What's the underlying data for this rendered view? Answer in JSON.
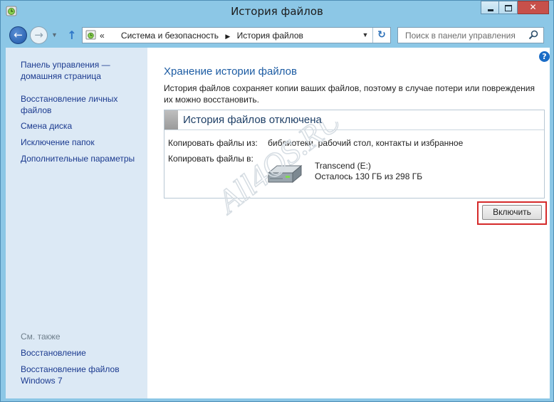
{
  "window": {
    "title": "История файлов"
  },
  "nav": {
    "breadcrumb_prefix": "«",
    "breadcrumb": [
      "Система и безопасность",
      "История файлов"
    ],
    "search_placeholder": "Поиск в панели управления"
  },
  "sidebar": {
    "items": [
      {
        "label": "Панель управления — домашняя страница"
      },
      {
        "label": "Восстановление личных файлов"
      },
      {
        "label": "Смена диска"
      },
      {
        "label": "Исключение папок"
      },
      {
        "label": "Дополнительные параметры"
      }
    ],
    "see_also_label": "См. также",
    "see_also": [
      {
        "label": "Восстановление"
      },
      {
        "label": "Восстановление файлов Windows 7"
      }
    ]
  },
  "main": {
    "heading": "Хранение истории файлов",
    "description": "История файлов сохраняет копии ваших файлов, поэтому в случае потери или повреждения их можно восстановить.",
    "status_title": "История файлов отключена",
    "copy_from_label": "Копировать файлы из:",
    "copy_from_value": "библиотеки, рабочий стол, контакты и избранное",
    "copy_to_label": "Копировать файлы в:",
    "drive_name": "Transcend (E:)",
    "drive_space": "Осталось 130 ГБ из 298 ГБ",
    "enable_button": "Включить"
  },
  "watermark": "All4OS.RU",
  "icons": {
    "app": "file-history-icon",
    "back": "back-arrow-icon",
    "forward": "forward-arrow-icon",
    "up": "up-arrow-icon",
    "refresh": "refresh-icon",
    "search": "search-icon",
    "help": "help-icon",
    "drive": "hard-drive-icon"
  },
  "colors": {
    "frame": "#8cc7e6",
    "sidebar": "#dce9f5",
    "heading": "#1d5ca3",
    "link": "#1b3a8f",
    "highlight": "#d52a2a",
    "close": "#c7504a"
  }
}
